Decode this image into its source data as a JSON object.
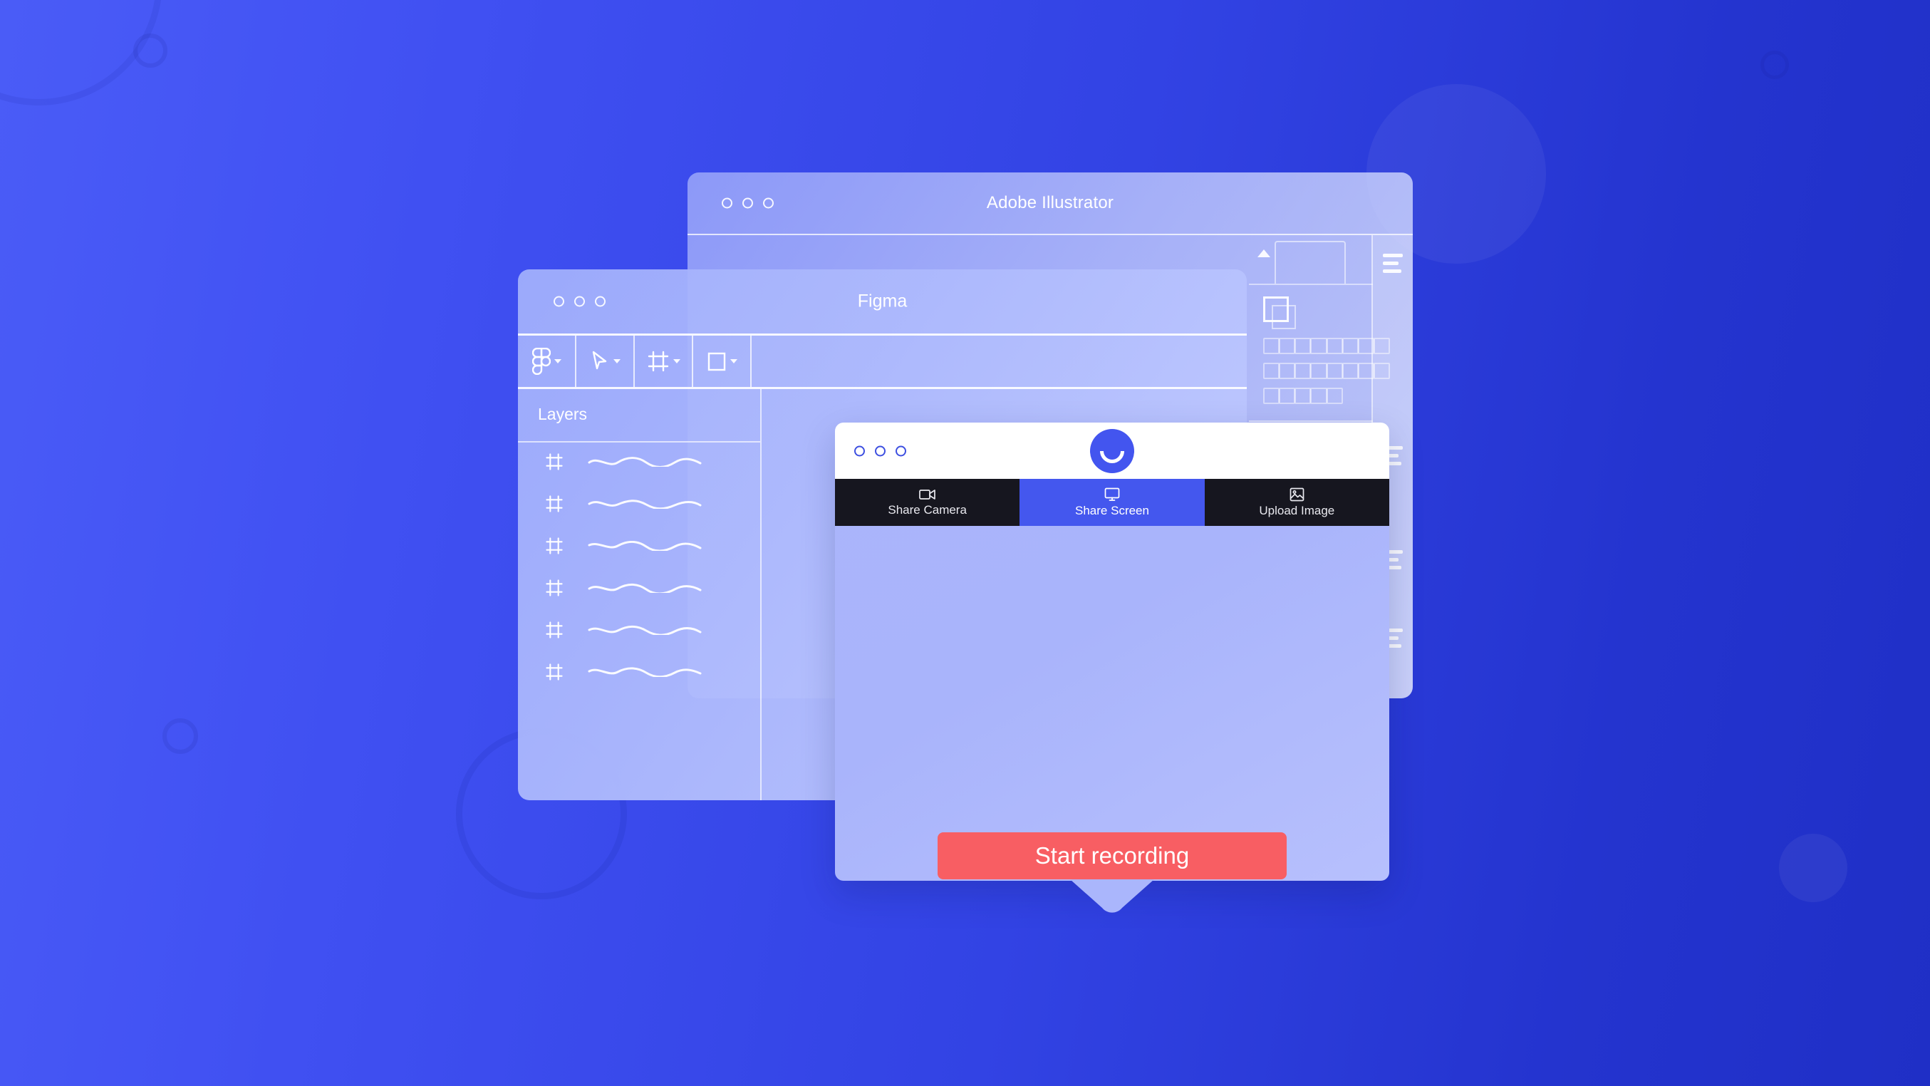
{
  "background": {
    "gradient_from": "#4a5cf7",
    "gradient_to": "#1f2fc6"
  },
  "windows": {
    "illustrator": {
      "title": "Adobe Illustrator",
      "traffic_lights": [
        "close",
        "minimize",
        "maximize"
      ],
      "panel": {
        "caret_icon": "chevron-up-icon",
        "fill_stroke_icon": "fill-stroke-swatch-icon",
        "swatch_rows": [
          8,
          8,
          5
        ],
        "menu_icon": "hamburger-menu-icon"
      }
    },
    "figma": {
      "title": "Figma",
      "traffic_lights": [
        "close",
        "minimize",
        "maximize"
      ],
      "toolbar": [
        {
          "name": "figma-logo-tool",
          "icon": "figma-logo-icon",
          "has_dropdown": true
        },
        {
          "name": "move-tool",
          "icon": "cursor-arrow-icon",
          "has_dropdown": true
        },
        {
          "name": "frame-tool",
          "icon": "frame-icon",
          "has_dropdown": true
        },
        {
          "name": "shape-tool",
          "icon": "rectangle-icon",
          "has_dropdown": true
        }
      ],
      "sidebar": {
        "panel_title": "Layers",
        "layers": [
          {
            "icon": "frame-icon",
            "placeholder": "squiggle-line"
          },
          {
            "icon": "frame-icon",
            "placeholder": "squiggle-line"
          },
          {
            "icon": "frame-icon",
            "placeholder": "squiggle-line"
          },
          {
            "icon": "frame-icon",
            "placeholder": "squiggle-line"
          },
          {
            "icon": "frame-icon",
            "placeholder": "squiggle-line"
          },
          {
            "icon": "frame-icon",
            "placeholder": "squiggle-line"
          }
        ]
      }
    }
  },
  "recorder_modal": {
    "traffic_lights": [
      "close",
      "minimize",
      "maximize"
    ],
    "brand_logo_icon": "smiley-face-logo-icon",
    "brand_color": "#4355ef",
    "tabs": [
      {
        "label": "Share Camera",
        "icon": "video-camera-icon",
        "active": false
      },
      {
        "label": "Share Screen",
        "icon": "monitor-icon",
        "active": true
      },
      {
        "label": "Upload Image",
        "icon": "image-icon",
        "active": false
      }
    ],
    "active_tab": "Share Screen",
    "primary_button": {
      "label": "Start recording",
      "color": "#f85e63",
      "text_color": "#ffffff"
    }
  }
}
